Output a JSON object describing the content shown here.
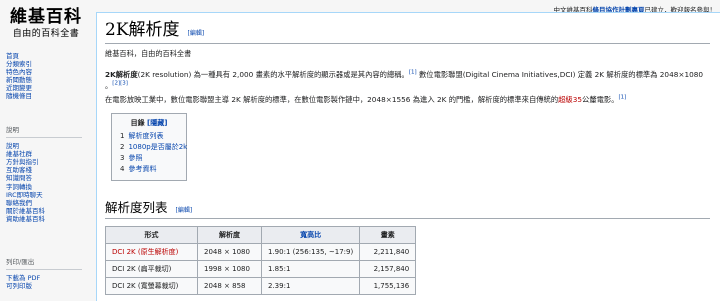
{
  "logo": {
    "line1": "維基百科",
    "line2": "自由的百科全書"
  },
  "sidebar": {
    "nav": [
      "首頁",
      "分類索引",
      "特色內容",
      "新聞動態",
      "近期變更",
      "隨機條目"
    ],
    "help_heading": "說明",
    "help": [
      "說明",
      "維基社群",
      "方針與指引",
      "互助客棧",
      "知識問答",
      "字詞轉換",
      "IRC即時聊天",
      "聯絡我們",
      "關於維基百科",
      "資助維基百科"
    ],
    "print_heading": "列印/匯出",
    "print": [
      "下載為 PDF",
      "可列印版"
    ]
  },
  "topbar": {
    "prefix": "中文維基百科",
    "bold": "條目協作計劃專頁",
    "suffix": "已建立，歡迎報名參與！"
  },
  "page": {
    "title": "2K解析度",
    "edit_label": "[編輯]",
    "tagline": "維基百科，自由的百科全書"
  },
  "intro": {
    "bold_term": "2K解析度",
    "p1_a": "(2K resolution) 為一種具有 2,000 畫素的水平解析度的顯示器或是其內容的總稱。",
    "ref1": "[1]",
    "p1_b": " 數位電影聯盟(Digital Cinema Initiatives,DCI) 定義 2K 解析度的標準為 2048×1080 。",
    "ref23": "[2][3]",
    "p2_a": "在電影放映工業中，數位電影聯盟主導 2K 解析度的標準，在數位電影製作鏈中，2048×1556 為進入 2K 的門檻，解析度的標準來自傳統的",
    "p2_red": "超級35",
    "p2_b": "公釐電影。",
    "ref1b": "[1]"
  },
  "toc": {
    "title": "目錄",
    "hide_label": "[隱藏]",
    "items": [
      {
        "num": "1",
        "label": "解析度列表"
      },
      {
        "num": "2",
        "label": "1080p是否屬於2k"
      },
      {
        "num": "3",
        "label": "參照"
      },
      {
        "num": "4",
        "label": "參考資料"
      }
    ]
  },
  "section": {
    "title": "解析度列表",
    "edit_label": "[編輯]"
  },
  "table": {
    "headers": [
      "形式",
      "解析度",
      "寬高比",
      "畫素"
    ],
    "rows": [
      {
        "format_link": "DCI 2K",
        "format_note": "(原生解析度)",
        "resolution": "2048 × 1080",
        "ratio": "1.90:1 (256:135, ~17:9)",
        "pixels": "2,211,840"
      },
      {
        "format_link": "",
        "format_note": "DCI 2K (扁平裁切)",
        "resolution": "1998 × 1080",
        "ratio": "1.85:1",
        "pixels": "2,157,840"
      },
      {
        "format_link": "",
        "format_note": "DCI 2K (寬螢幕裁切)",
        "resolution": "2048 × 858",
        "ratio": "2.39:1",
        "pixels": "1,755,136"
      }
    ]
  }
}
